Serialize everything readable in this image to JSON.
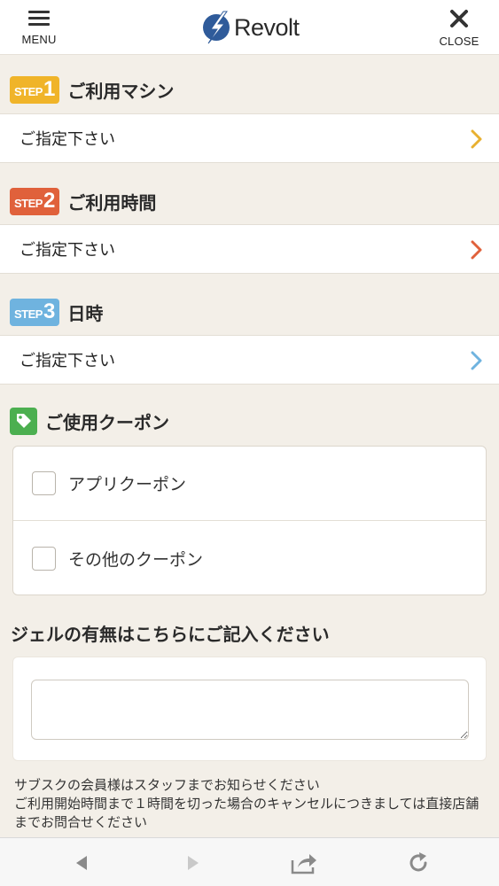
{
  "header": {
    "menu_label": "MENU",
    "close_label": "CLOSE",
    "logo_text": "Revolt",
    "brand_color": "#2f5b9a"
  },
  "steps": [
    {
      "badge_word": "STEP",
      "badge_num": "1",
      "title": "ご利用マシン",
      "value": "ご指定下さい",
      "color": "#f0b429",
      "chevron_color": "#e8b030"
    },
    {
      "badge_word": "STEP",
      "badge_num": "2",
      "title": "ご利用時間",
      "value": "ご指定下さい",
      "color": "#e0613b",
      "chevron_color": "#e0613b"
    },
    {
      "badge_word": "STEP",
      "badge_num": "3",
      "title": "日時",
      "value": "ご指定下さい",
      "color": "#6fb3df",
      "chevron_color": "#6fb3df"
    }
  ],
  "coupon": {
    "title": "ご使用クーポン",
    "icon": "tag-icon",
    "options": [
      {
        "label": "アプリクーポン",
        "checked": false
      },
      {
        "label": "その他のクーポン",
        "checked": false
      }
    ]
  },
  "gel": {
    "title": "ジェルの有無はこちらにご記入ください",
    "value": ""
  },
  "notes": [
    "サブスクの会員様はスタッフまでお知らせください",
    "ご利用開始時間まで１時間を切った場合のキャンセルにつきましては直接店舗までお問合せください"
  ],
  "bottom_nav": [
    "back-icon",
    "forward-icon",
    "share-icon",
    "reload-icon"
  ]
}
